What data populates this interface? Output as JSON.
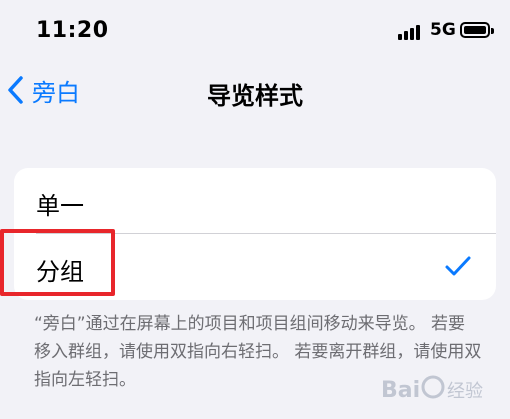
{
  "status_bar": {
    "time": "11:20",
    "network": "5G"
  },
  "nav": {
    "back_label": "旁白",
    "title": "导览样式"
  },
  "options": [
    {
      "label": "单一",
      "selected": false
    },
    {
      "label": "分组",
      "selected": true
    }
  ],
  "footer_note": "“旁白”通过在屏幕上的项目和项目组间移动来导览。 若要移入群组，请使用双指向右轻扫。 若要离开群组，请使用双指向左轻扫。",
  "colors": {
    "accent": "#0a7aff",
    "highlight": "#e8262b",
    "background": "#f2f2f7"
  },
  "watermark": {
    "text": "Baidu经验"
  }
}
